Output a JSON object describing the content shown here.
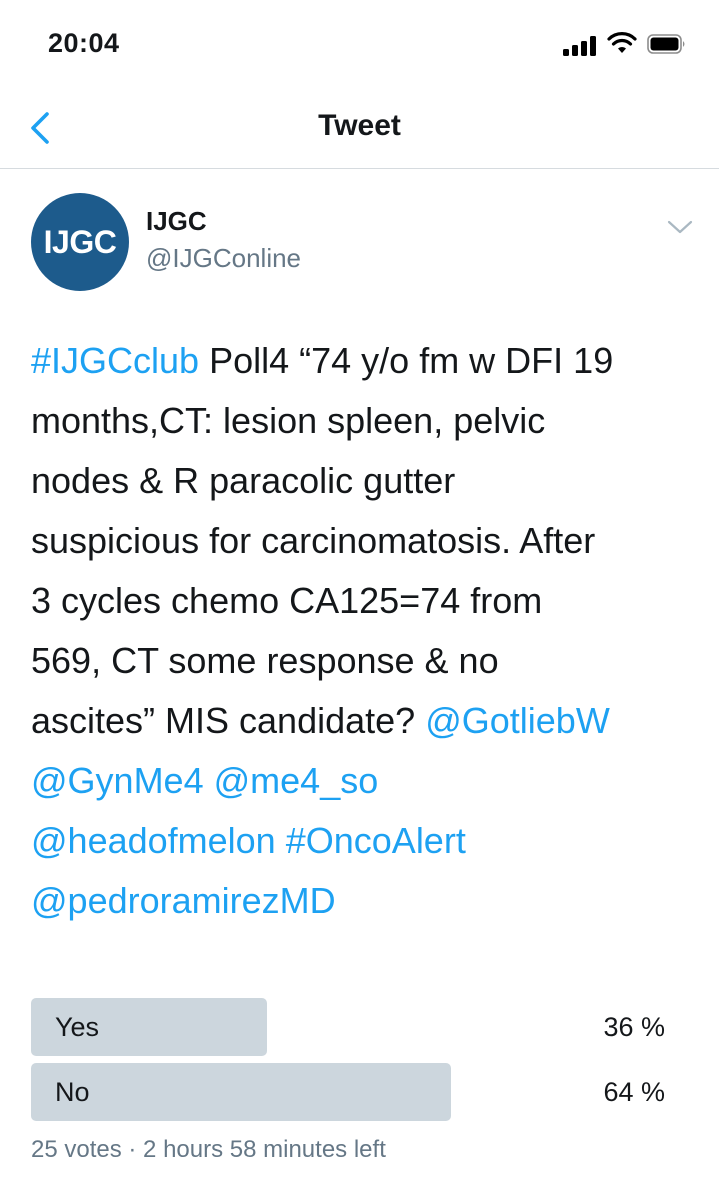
{
  "status_bar": {
    "time": "20:04",
    "icons": [
      "cellular-signal-icon",
      "wifi-icon",
      "battery-icon"
    ]
  },
  "nav": {
    "back_icon": "chevron-left-icon",
    "title": "Tweet"
  },
  "tweet": {
    "author": {
      "avatar_text": "IJGC",
      "name": "IJGC",
      "handle": "@IJGConline"
    },
    "menu_icon": "chevron-down-icon",
    "lines": [
      [
        {
          "text": "#IJGCclub",
          "link": true
        },
        {
          "text": " Poll4 “74 y/o fm w DFI 19",
          "link": false
        }
      ],
      [
        {
          "text": "months,CT: lesion spleen, pelvic",
          "link": false
        }
      ],
      [
        {
          "text": "nodes & R paracolic gutter",
          "link": false
        }
      ],
      [
        {
          "text": "suspicious for carcinomatosis. After",
          "link": false
        }
      ],
      [
        {
          "text": "3 cycles chemo CA125=74 from",
          "link": false
        }
      ],
      [
        {
          "text": "569, CT some response & no",
          "link": false
        }
      ],
      [
        {
          "text": "ascites” MIS candidate? ",
          "link": false
        },
        {
          "text": "@GotliebW",
          "link": true
        }
      ],
      [
        {
          "text": "@GynMe4",
          "link": true
        },
        {
          "text": " ",
          "link": false
        },
        {
          "text": "@me4_so",
          "link": true
        }
      ],
      [
        {
          "text": "@headofmelon",
          "link": true
        },
        {
          "text": " ",
          "link": false
        },
        {
          "text": "#OncoAlert",
          "link": true
        }
      ],
      [
        {
          "text": "@pedroramirezMD",
          "link": true
        }
      ]
    ]
  },
  "poll": {
    "options": [
      {
        "label": "Yes",
        "percent_text": "36 %",
        "percent": 36
      },
      {
        "label": "No",
        "percent_text": "64 %",
        "percent": 64
      }
    ],
    "footer": "25 votes · 2 hours 58 minutes left"
  },
  "colors": {
    "link": "#1da1f2",
    "avatar_bg": "#1d5b8c",
    "poll_bar": "#ccd6dd",
    "secondary_text": "#657786"
  }
}
